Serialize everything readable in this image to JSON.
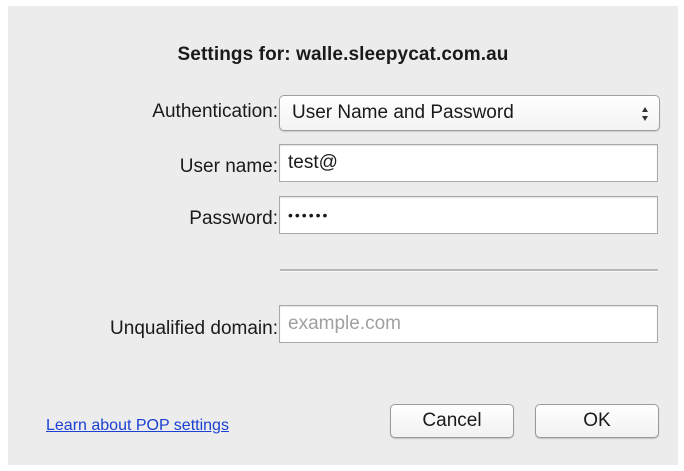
{
  "dialog": {
    "title": "Settings for: walle.sleepycat.com.au"
  },
  "authentication": {
    "label": "Authentication:",
    "selected": "User Name and Password",
    "icon": "up-down-arrows-icon"
  },
  "username": {
    "label": "User name:",
    "value": "test@"
  },
  "password": {
    "label": "Password:",
    "value": "••••••"
  },
  "unqualified_domain": {
    "label": "Unqualified domain:",
    "value": "",
    "placeholder": "example.com"
  },
  "footer": {
    "learn_link": "Learn about POP settings",
    "cancel_label": "Cancel",
    "ok_label": "OK"
  },
  "colors": {
    "background": "#ececec",
    "link": "#1a3fd1"
  }
}
